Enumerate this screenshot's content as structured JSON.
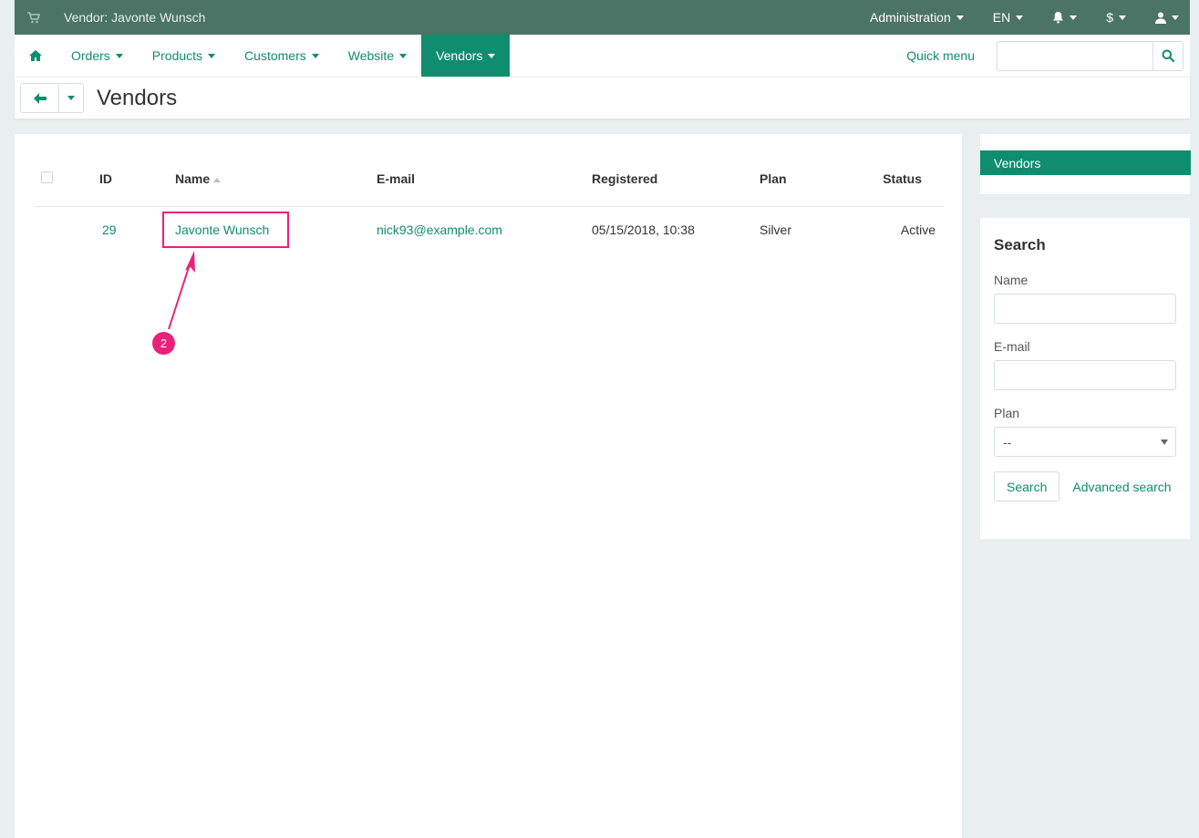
{
  "topbar": {
    "store_title": "Vendor: Javonte Wunsch",
    "administration": "Administration",
    "language": "EN",
    "currency": "$"
  },
  "nav": {
    "items": [
      {
        "label": "Orders"
      },
      {
        "label": "Products"
      },
      {
        "label": "Customers"
      },
      {
        "label": "Website"
      },
      {
        "label": "Vendors"
      }
    ],
    "quick_menu": "Quick menu",
    "search_placeholder": ""
  },
  "page": {
    "title": "Vendors"
  },
  "table": {
    "headers": {
      "id": "ID",
      "name": "Name",
      "email": "E-mail",
      "registered": "Registered",
      "plan": "Plan",
      "status": "Status"
    },
    "rows": [
      {
        "id": "29",
        "name": "Javonte Wunsch",
        "email": "nick93@example.com",
        "registered": "05/15/2018, 10:38",
        "plan": "Silver",
        "status": "Active"
      }
    ]
  },
  "annotation": {
    "badge": "2"
  },
  "side_menu": {
    "item": "Vendors"
  },
  "search_panel": {
    "title": "Search",
    "name_label": "Name",
    "email_label": "E-mail",
    "plan_label": "Plan",
    "plan_value": "--",
    "search_button": "Search",
    "advanced_link": "Advanced search"
  },
  "colors": {
    "accent": "#0f8d6f",
    "topbar": "#4b7366",
    "annotation": "#e9217a"
  }
}
